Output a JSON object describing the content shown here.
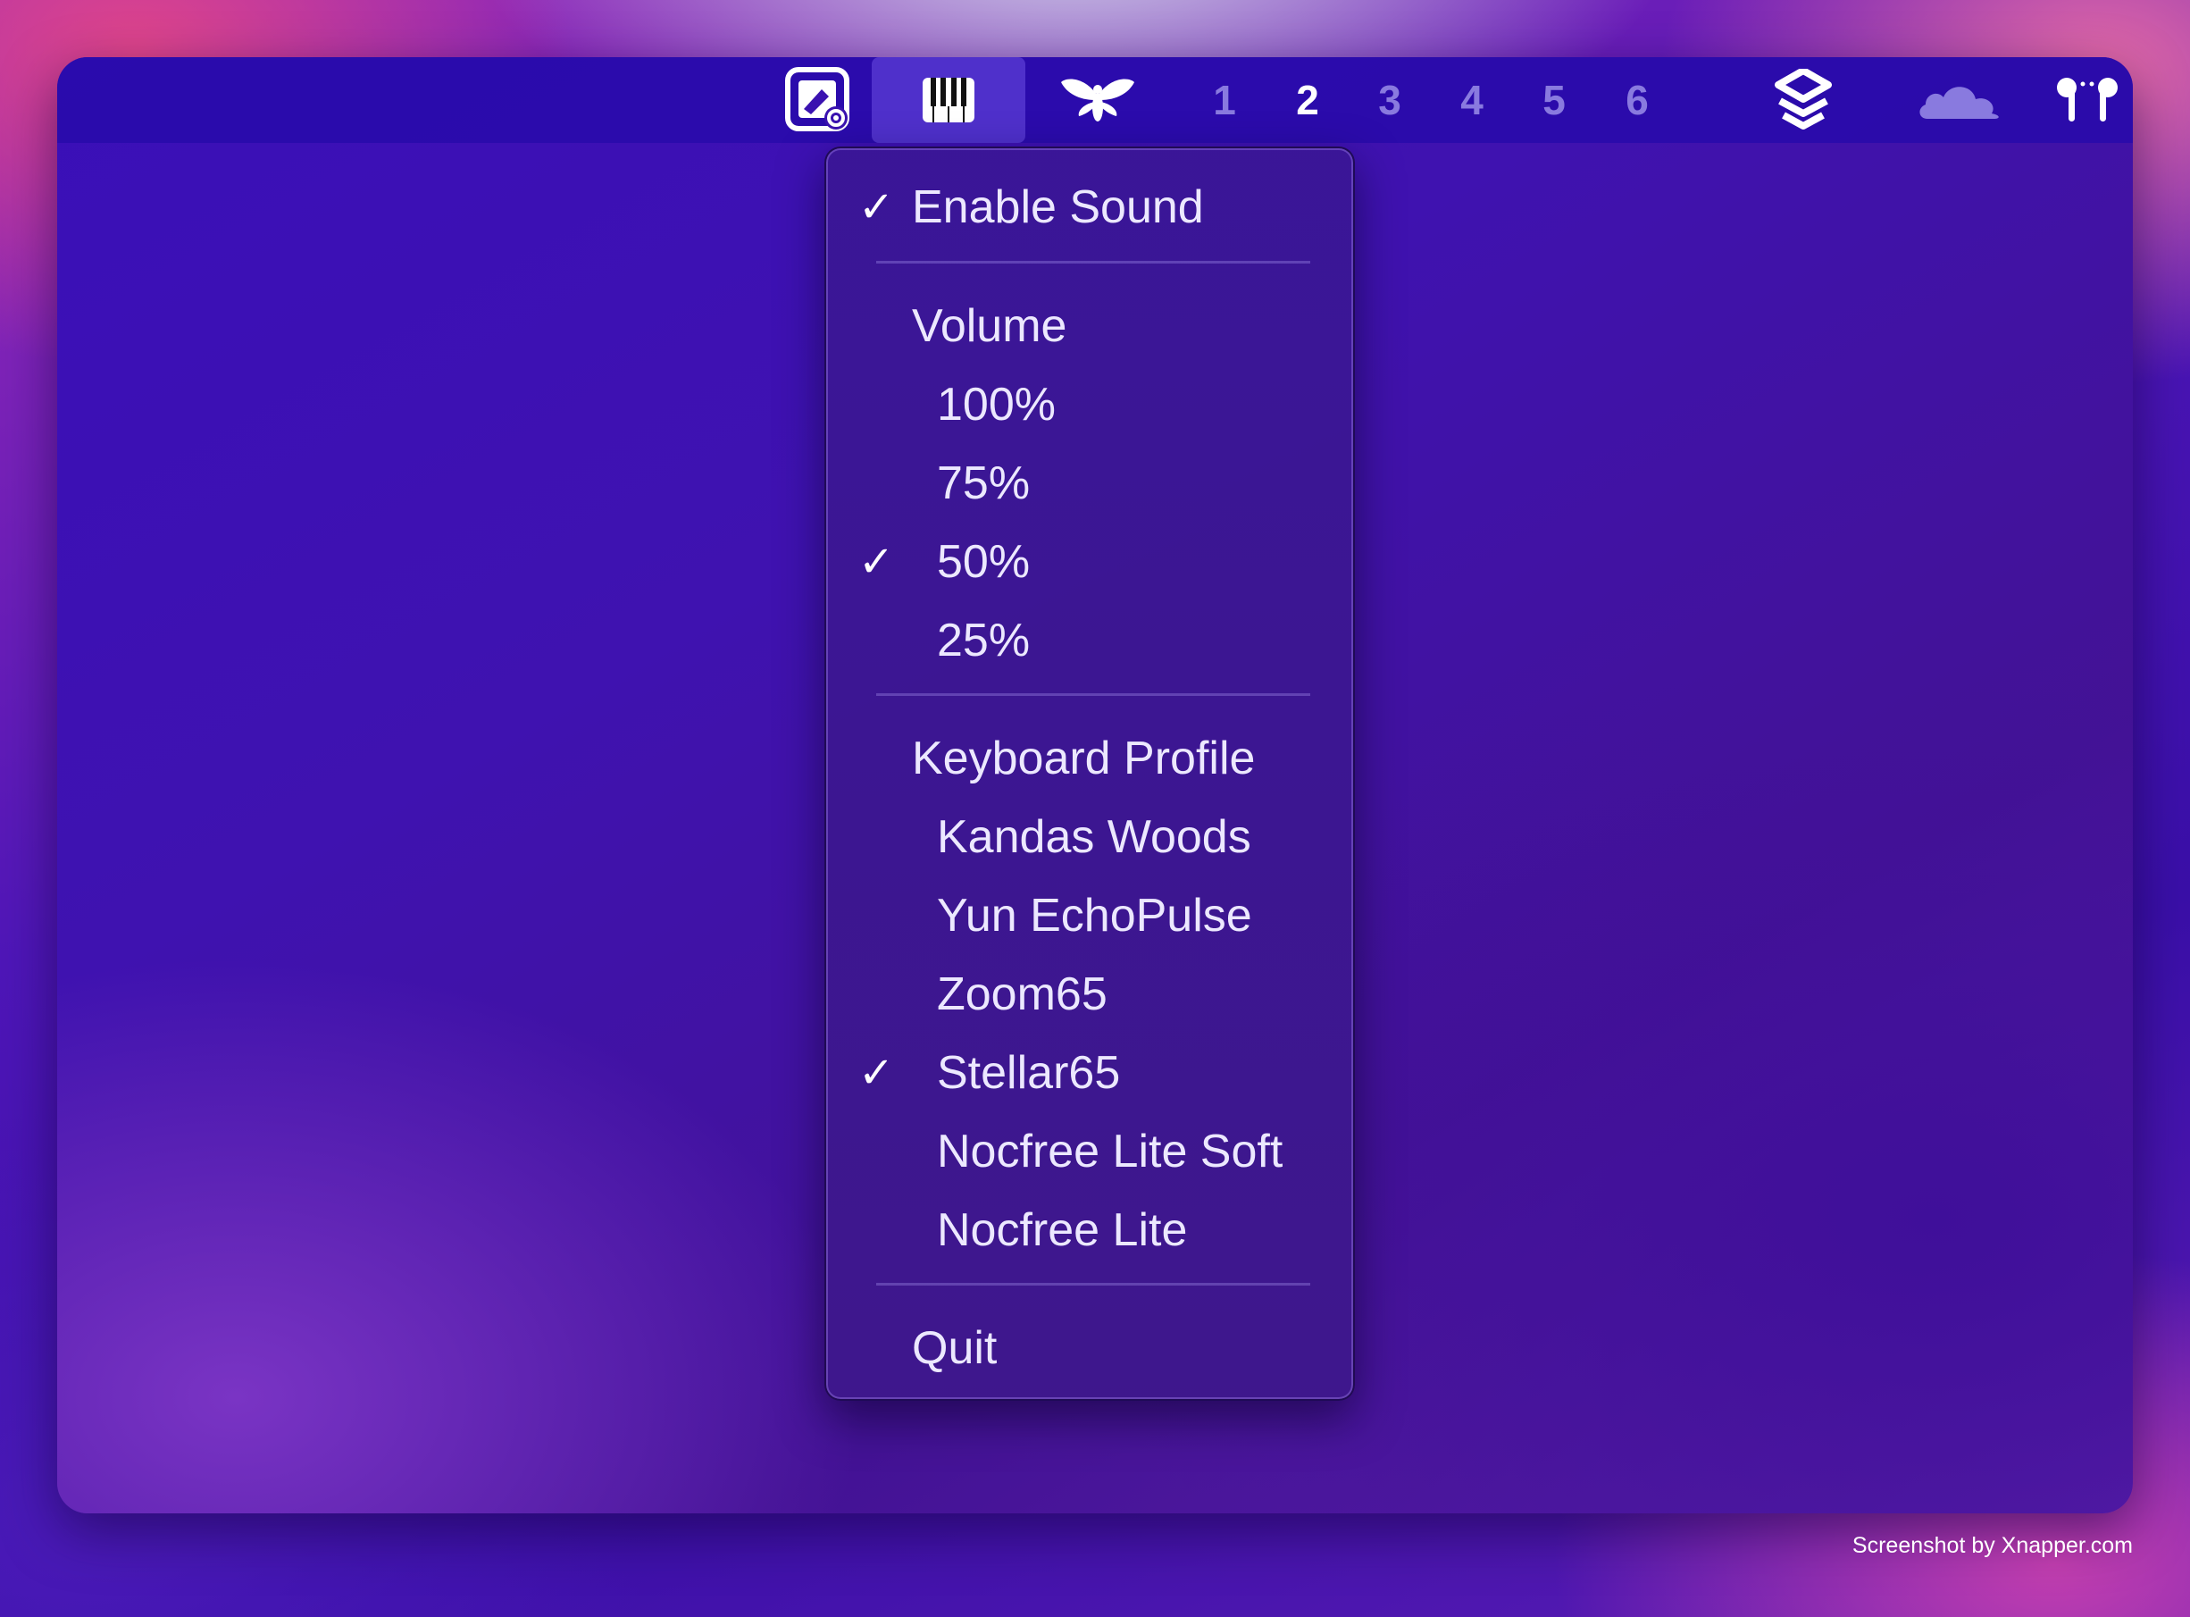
{
  "menubar": {
    "icons": [
      "screen-capture-icon",
      "piano-keys-icon",
      "bee-icon",
      "layers-icon",
      "cloud-icon",
      "airpods-icon"
    ],
    "spaces": [
      "1",
      "2",
      "3",
      "4",
      "5",
      "6"
    ],
    "current_space": "2"
  },
  "menu": {
    "enable_sound": "Enable Sound",
    "volume_header": "Volume",
    "volume_options": [
      "100%",
      "75%",
      "50%",
      "25%"
    ],
    "volume_selected": "50%",
    "profile_header": "Keyboard Profile",
    "profiles": [
      "Kandas Woods",
      "Yun EchoPulse",
      "Zoom65",
      "Stellar65",
      "Nocfree Lite Soft",
      "Nocfree Lite"
    ],
    "profile_selected": "Stellar65",
    "quit": "Quit",
    "check_glyph": "✓"
  },
  "footer": {
    "credit": "Screenshot by Xnapper.com"
  }
}
